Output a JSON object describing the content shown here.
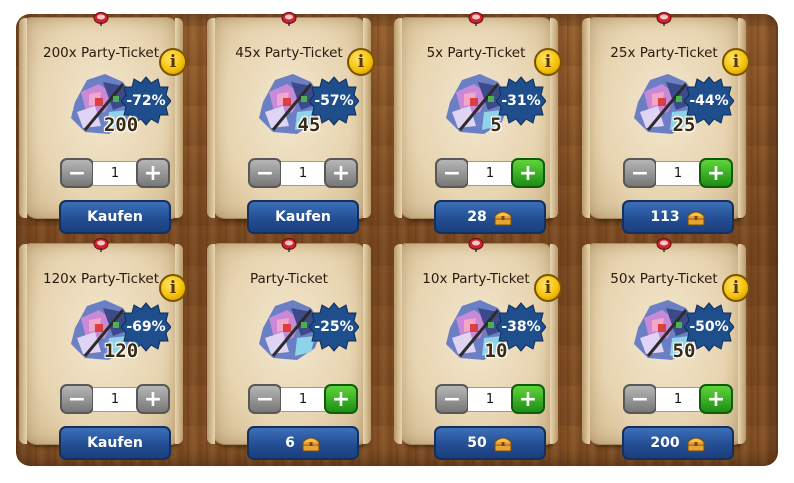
{
  "theme": {
    "badge_color": "#1f4e8c",
    "button_blue": "#234e94",
    "plus_green": "#2a9a1e",
    "info_yellow": "#f5c20a",
    "pin_red": "#d0242c"
  },
  "icons": {
    "item": "party-ticket-icon",
    "info": "info-icon",
    "currency": "treasure-chest-icon",
    "pin": "pushpin-icon"
  },
  "offers": [
    {
      "title": "200x Party-Ticket",
      "discount": "-72%",
      "quantity_label": "200",
      "amount": "1",
      "button": "Kaufen",
      "price": "",
      "has_info": true,
      "plus_enabled": false
    },
    {
      "title": "45x Party-Ticket",
      "discount": "-57%",
      "quantity_label": "45",
      "amount": "1",
      "button": "Kaufen",
      "price": "",
      "has_info": true,
      "plus_enabled": false
    },
    {
      "title": "5x Party-Ticket",
      "discount": "-31%",
      "quantity_label": "5",
      "amount": "1",
      "button": "",
      "price": "28",
      "has_info": true,
      "plus_enabled": true
    },
    {
      "title": "25x Party-Ticket",
      "discount": "-44%",
      "quantity_label": "25",
      "amount": "1",
      "button": "",
      "price": "113",
      "has_info": true,
      "plus_enabled": true
    },
    {
      "title": "120x Party-Ticket",
      "discount": "-69%",
      "quantity_label": "120",
      "amount": "1",
      "button": "Kaufen",
      "price": "",
      "has_info": true,
      "plus_enabled": false
    },
    {
      "title": "Party-Ticket",
      "discount": "-25%",
      "quantity_label": "",
      "amount": "1",
      "button": "",
      "price": "6",
      "has_info": false,
      "plus_enabled": true
    },
    {
      "title": "10x Party-Ticket",
      "discount": "-38%",
      "quantity_label": "10",
      "amount": "1",
      "button": "",
      "price": "50",
      "has_info": true,
      "plus_enabled": true
    },
    {
      "title": "50x Party-Ticket",
      "discount": "-50%",
      "quantity_label": "50",
      "amount": "1",
      "button": "",
      "price": "200",
      "has_info": true,
      "plus_enabled": true
    }
  ]
}
